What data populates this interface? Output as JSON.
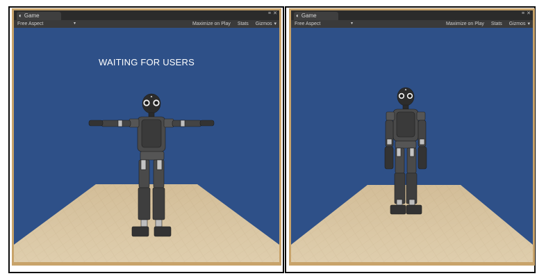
{
  "panels": [
    {
      "tab": {
        "icon": "unity-logo-icon",
        "label": "Game"
      },
      "toolbar": {
        "aspect": "Free Aspect",
        "maximize": "Maximize on Play",
        "stats": "Stats",
        "gizmos": "Gizmos"
      },
      "overlay_text": "WAITING FOR USERS",
      "robot_pose": "t-pose"
    },
    {
      "tab": {
        "icon": "unity-logo-icon",
        "label": "Game"
      },
      "toolbar": {
        "aspect": "Free Aspect",
        "maximize": "Maximize on Play",
        "stats": "Stats",
        "gizmos": "Gizmos"
      },
      "overlay_text": "",
      "robot_pose": "arms-down"
    }
  ],
  "colors": {
    "sky": "#2e5088",
    "floor": "#d8c4a0",
    "window_border": "#c8a36a",
    "robot": "#3c3c3c"
  }
}
